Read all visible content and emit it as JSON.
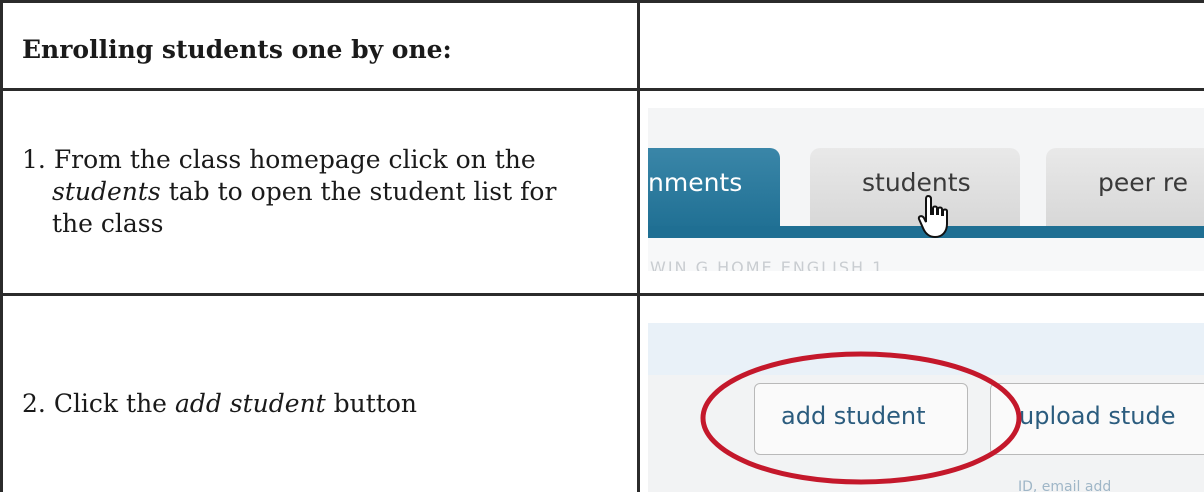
{
  "header": {
    "title": "Enrolling students one by one:"
  },
  "steps": [
    {
      "number": "1.",
      "text_before": "From the class homepage click on the",
      "italic": "students",
      "text_after": "tab to open the student list for",
      "text_end": "the class"
    },
    {
      "number": "2.",
      "text_before": "Click the",
      "italic": "add student",
      "text_after": "button"
    }
  ],
  "screenshot1": {
    "tab_active": "nments",
    "tab_students": "students",
    "tab_peer": "peer re",
    "faded_text": "WIN G  HOME  ENGLISH 1"
  },
  "screenshot2": {
    "add_student": "add student",
    "upload_students": "upload stude",
    "bottom_hint": "ID, email add"
  },
  "colors": {
    "accent_tab": "#1f6f93",
    "ellipse": "#c4182b"
  }
}
